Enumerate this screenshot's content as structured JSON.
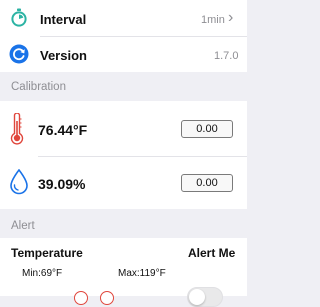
{
  "settings": {
    "interval": {
      "label": "Interval",
      "value": "1min",
      "chevron": "›"
    },
    "version": {
      "label": "Version",
      "value": "1.7.0"
    }
  },
  "calibration": {
    "header": "Calibration",
    "temperature": {
      "reading": "76.44°F",
      "offset": "0.00",
      "icon": "thermometer-icon"
    },
    "humidity": {
      "reading": "39.09%",
      "offset": "0.00",
      "icon": "water-drop-icon"
    }
  },
  "alert": {
    "header": "Alert",
    "temperature_label": "Temperature",
    "alert_me_label": "Alert Me",
    "min_label": "Min:69°F",
    "max_label": "Max:119°F",
    "enabled": false
  },
  "colors": {
    "accent_teal": "#2bb3a3",
    "accent_blue": "#1a73e8",
    "thermometer_red": "#e0463c",
    "background": "#efeff4"
  }
}
